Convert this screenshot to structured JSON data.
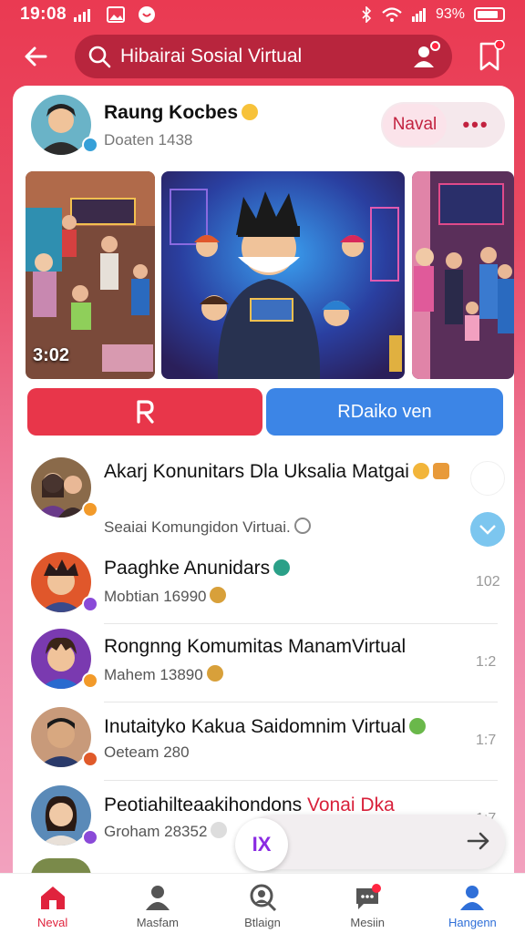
{
  "status_bar": {
    "time": "19:08",
    "battery": "93%"
  },
  "search": {
    "text": "Hibairai Sosial Virtual"
  },
  "profile": {
    "name": "Raung Kocbes",
    "sub": "Doaten 1438",
    "pill_label": "Naval",
    "more_label": "•••"
  },
  "media": {
    "duration": "3:02"
  },
  "actions": {
    "left_label": "R",
    "right_label": "RDaiko ven"
  },
  "list": [
    {
      "title": "Akarj Konunitars Dla Uksalia Matgai",
      "sub": "Seaiai Komungidon Virtuai.",
      "time": ""
    },
    {
      "title": "Paaghke Anunidars",
      "sub": "Mobtian 16990",
      "time": "102"
    },
    {
      "title": "Rongnng Komumitas ManamVirtual",
      "sub": "Mahem 13890",
      "time": "1:2"
    },
    {
      "title": "Inutaityko Kakua Saidomnim Virtual",
      "sub": "Oeteam 280",
      "time": "1:7"
    },
    {
      "title_main": "Peotiahilteaakihondons",
      "title_accent": "Vonai Dka",
      "sub": "Groham 28352",
      "time": "1:7"
    }
  ],
  "fab": {
    "label": "IX"
  },
  "nav": [
    {
      "label": "Neval",
      "active": true
    },
    {
      "label": "Masfam",
      "active": false
    },
    {
      "label": "Btlaign",
      "active": false
    },
    {
      "label": "Mesiin",
      "active": false
    },
    {
      "label": "Hangenn",
      "active": false
    }
  ],
  "colors": {
    "brand": "#e8364a",
    "accent_blue": "#3c85e6",
    "active_nav": "#e0233d",
    "profile_nav": "#2f6fd8"
  }
}
